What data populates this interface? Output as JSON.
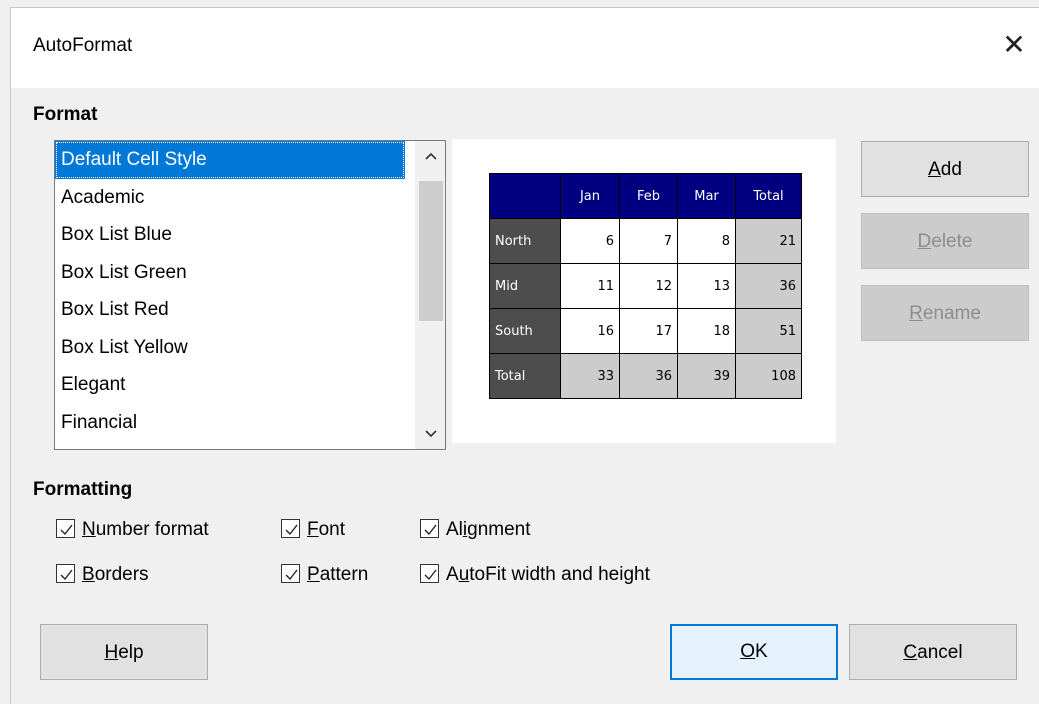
{
  "dialog": {
    "title": "AutoFormat"
  },
  "format_section": {
    "label": "Format"
  },
  "format_list": {
    "items": [
      "Default Cell Style",
      "Academic",
      "Box List Blue",
      "Box List Green",
      "Box List Red",
      "Box List Yellow",
      "Elegant",
      "Financial"
    ],
    "selected": "Default Cell Style"
  },
  "preview": {
    "header": [
      "Jan",
      "Feb",
      "Mar",
      "Total"
    ],
    "rows": [
      {
        "label": "North",
        "values": [
          "6",
          "7",
          "8"
        ],
        "total": "21"
      },
      {
        "label": "Mid",
        "values": [
          "11",
          "12",
          "13"
        ],
        "total": "36"
      },
      {
        "label": "South",
        "values": [
          "16",
          "17",
          "18"
        ],
        "total": "51"
      },
      {
        "label": "Total",
        "values": [
          "33",
          "36",
          "39"
        ],
        "total": "108"
      }
    ]
  },
  "side_buttons": {
    "add": {
      "pre": "",
      "key": "A",
      "post": "dd"
    },
    "delete": {
      "pre": "",
      "key": "D",
      "post": "elete"
    },
    "rename": {
      "pre": "",
      "key": "R",
      "post": "ename"
    }
  },
  "formatting_section": {
    "label": "Formatting"
  },
  "options": {
    "number_format": {
      "pre": "",
      "key": "N",
      "post": "umber format",
      "checked": true
    },
    "font": {
      "pre": "",
      "key": "F",
      "post": "ont",
      "checked": true
    },
    "alignment": {
      "pre": "Al",
      "key": "i",
      "post": "gnment",
      "checked": true
    },
    "borders": {
      "pre": "",
      "key": "B",
      "post": "orders",
      "checked": true
    },
    "pattern": {
      "pre": "",
      "key": "P",
      "post": "attern",
      "checked": true
    },
    "autofit": {
      "pre": "A",
      "key": "u",
      "post": "toFit width and height",
      "checked": true
    }
  },
  "footer": {
    "help": {
      "pre": "",
      "key": "H",
      "post": "elp"
    },
    "ok": {
      "pre": "",
      "key": "O",
      "post": "K"
    },
    "cancel": {
      "pre": "",
      "key": "C",
      "post": "ancel"
    }
  },
  "colors": {
    "selection": "#0078d7",
    "preview_header": "#000080",
    "preview_rowhead": "#4d4d4d",
    "preview_total": "#cccccc"
  }
}
